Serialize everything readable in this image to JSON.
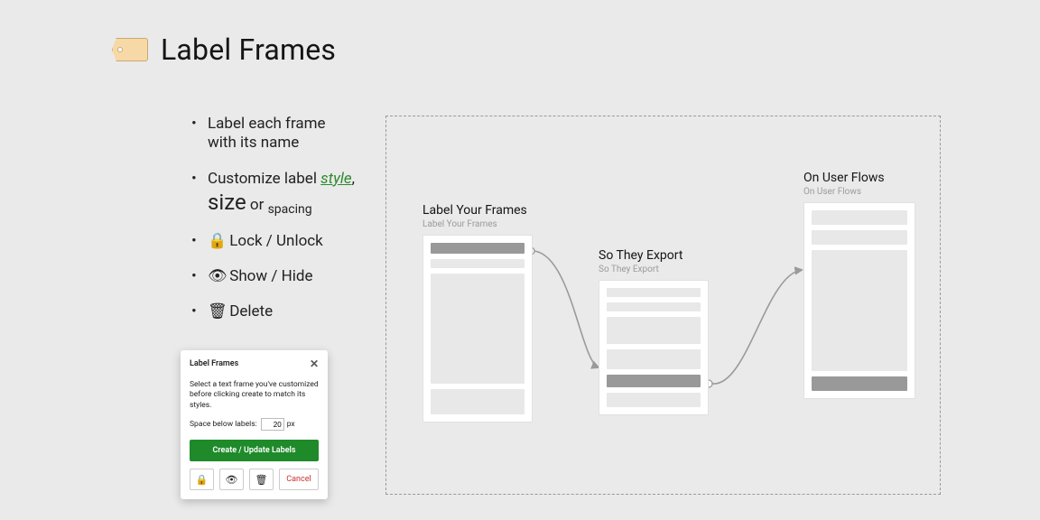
{
  "header": {
    "title": "Label Frames"
  },
  "bullets": {
    "b1a": "Label each frame",
    "b1b": "with its name",
    "b2a": "Customize label ",
    "b2_style": "style",
    "b2_comma": ",",
    "b2_size": "size",
    "b2_or": " or ",
    "b2_spacing": "spacing",
    "b3": "Lock / Unlock",
    "b4": "Show / Hide",
    "b5": "Delete"
  },
  "dialog": {
    "title": "Label Frames",
    "description": "Select a text frame you've customized before clicking create to match its styles.",
    "space_label": "Space below labels:",
    "space_value": "20",
    "space_unit": "px",
    "primary": "Create / Update Labels",
    "cancel": "Cancel"
  },
  "canvas": {
    "frames": {
      "f1_title": "Label Your Frames",
      "f1_sub": "Label Your Frames",
      "f2_title": "So They Export",
      "f2_sub": "So They Export",
      "f3_title": "On User Flows",
      "f3_sub": "On User Flows"
    }
  }
}
